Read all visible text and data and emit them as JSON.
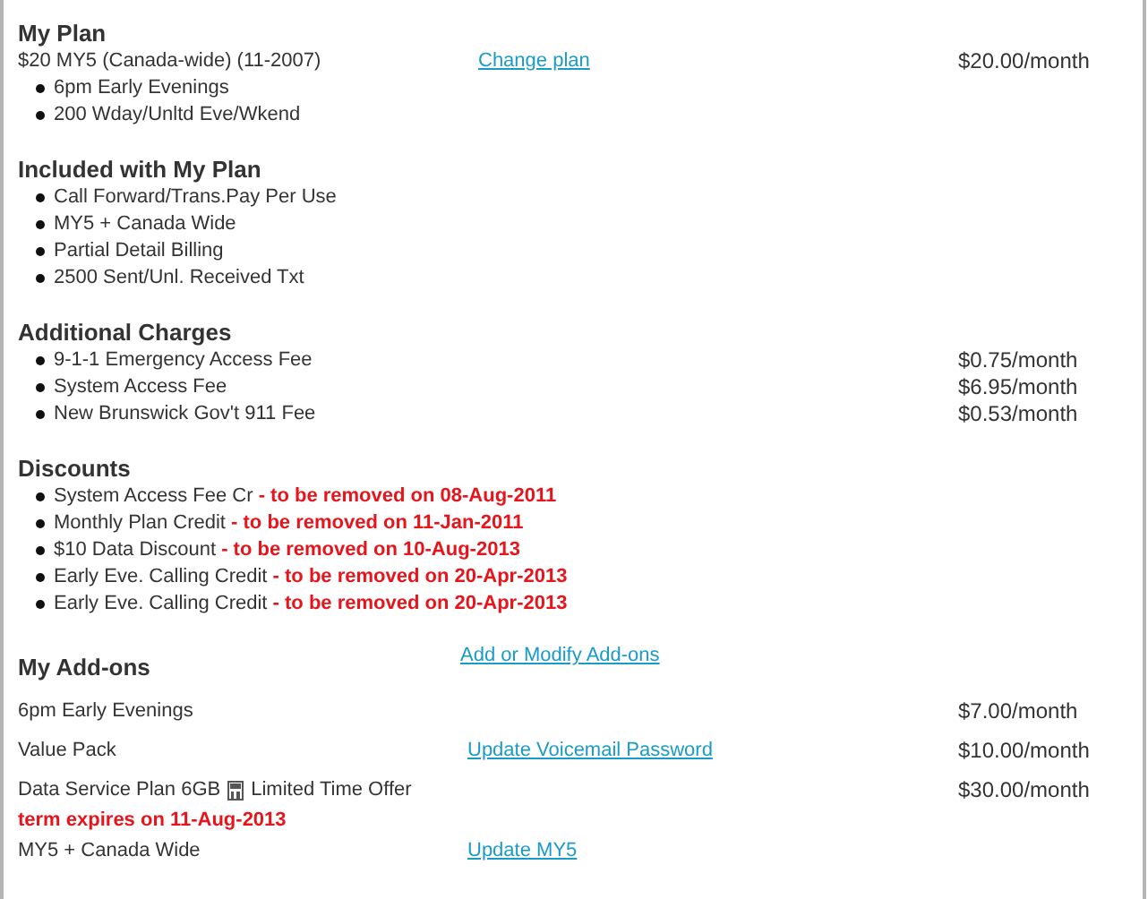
{
  "plan": {
    "heading": "My Plan",
    "name": "$20 MY5 (Canada-wide) (11-2007)",
    "link": "Change plan",
    "price": "$20.00/month",
    "features": [
      "6pm Early Evenings",
      "200 Wday/Unltd Eve/Wkend"
    ]
  },
  "included": {
    "heading": "Included with My Plan",
    "items": [
      "Call Forward/Trans.Pay Per Use",
      "MY5 + Canada Wide",
      "Partial Detail Billing",
      "2500 Sent/Unl. Received Txt"
    ]
  },
  "additional_charges": {
    "heading": "Additional Charges",
    "items": [
      {
        "label": "9-1-1 Emergency Access Fee",
        "price": "$0.75/month"
      },
      {
        "label": "System Access Fee",
        "price": "$6.95/month"
      },
      {
        "label": "New Brunswick Gov't 911 Fee",
        "price": "$0.53/month"
      }
    ]
  },
  "discounts": {
    "heading": "Discounts",
    "items": [
      {
        "label": "System Access Fee Cr",
        "note": "- to be removed on 08-Aug-2011"
      },
      {
        "label": "Monthly Plan Credit",
        "note": "- to be removed on 11-Jan-2011"
      },
      {
        "label": "$10 Data Discount",
        "note": "- to be removed on 10-Aug-2013"
      },
      {
        "label": "Early Eve. Calling Credit",
        "note": "- to be removed on 20-Apr-2013"
      },
      {
        "label": "Early Eve. Calling Credit",
        "note": "- to be removed on 20-Apr-2013"
      }
    ]
  },
  "addons": {
    "heading": "My Add-ons",
    "link": "Add or Modify Add-ons",
    "items": [
      {
        "name": "6pm Early Evenings",
        "price": "$7.00/month"
      },
      {
        "name": "Value Pack",
        "link": "Update Voicemail Password",
        "price": "$10.00/month"
      },
      {
        "name": "Data Service Plan 6GB",
        "offer": "Limited Time Offer",
        "term": "term expires on 11-Aug-2013",
        "price": "$30.00/month"
      },
      {
        "name": "MY5 + Canada Wide",
        "link": "Update MY5"
      }
    ]
  }
}
